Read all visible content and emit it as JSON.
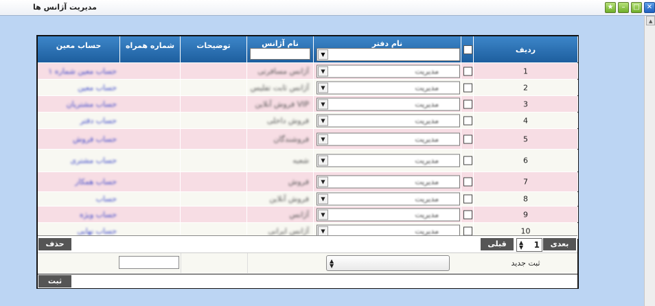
{
  "window": {
    "title": "مدیریت آژانس ها"
  },
  "columns": {
    "row": "ردیف",
    "office": "نام دفتر",
    "agency": "نام آژانس",
    "desc": "توضیحات",
    "phone": "شماره همراه",
    "account": "حساب معین"
  },
  "rows": [
    {
      "n": "1",
      "office": "مدیریت",
      "agency": "آژانس مسافرتی",
      "account": "حساب معین شماره ۱"
    },
    {
      "n": "2",
      "office": "مدیریت",
      "agency": "آژانس ثابت تفلیس",
      "account": "حساب معین"
    },
    {
      "n": "3",
      "office": "مدیریت",
      "agency": "فروش آنلاین VIP",
      "account": "حساب مشتریان"
    },
    {
      "n": "4",
      "office": "مدیریت",
      "agency": "فروش داخلی",
      "account": "حساب دفتر"
    },
    {
      "n": "5",
      "office": "مدیریت",
      "agency": "فروشندگان",
      "account": "حساب فروش"
    },
    {
      "n": "6",
      "office": "مدیریت",
      "agency": "شعبه",
      "account": "حساب مشتری"
    },
    {
      "n": "7",
      "office": "مدیریت",
      "agency": "فروش",
      "account": "حساب همکار"
    },
    {
      "n": "8",
      "office": "مدیریت",
      "agency": "فروش آنلاین",
      "account": "حساب"
    },
    {
      "n": "9",
      "office": "مدیریت",
      "agency": "آژانس",
      "account": "حساب ویژه"
    },
    {
      "n": "10",
      "office": "مدیریت",
      "agency": "آژانس ایرانی",
      "account": "حساب نهایی"
    }
  ],
  "pager": {
    "next": "بعدی",
    "prev": "قبلی",
    "page": "1",
    "delete": "حذف"
  },
  "new_entry": {
    "label": "ثبت جدید",
    "submit": "ثبت"
  }
}
